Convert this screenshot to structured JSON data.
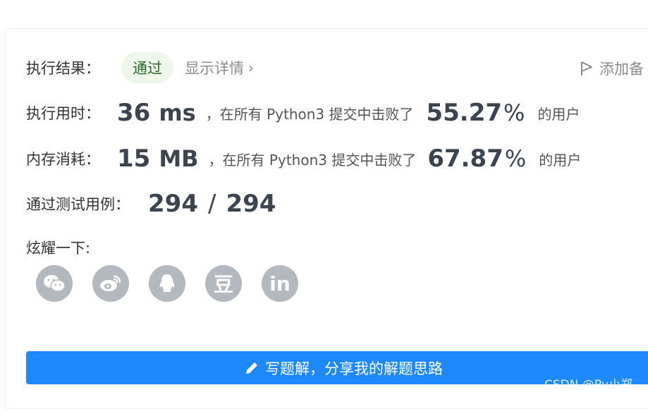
{
  "result": {
    "label": "执行结果：",
    "status": "通过",
    "details_link": "显示详情",
    "add_note": "添加备"
  },
  "runtime": {
    "label": "执行用时：",
    "value": "36",
    "unit": "ms",
    "text_before": "，在所有 Python3 提交中击败了",
    "percent": "55.27",
    "percent_sign": "%",
    "text_after": "的用户"
  },
  "memory": {
    "label": "内存消耗：",
    "value": "15",
    "unit": "MB",
    "text_before": "，在所有 Python3 提交中击败了",
    "percent": "67.87",
    "percent_sign": "%",
    "text_after": "的用户"
  },
  "tests": {
    "label": "通过测试用例：",
    "passed": "294",
    "separator": "/",
    "total": "294"
  },
  "share": {
    "label": "炫耀一下:",
    "icons": [
      "wechat-icon",
      "weibo-icon",
      "qq-icon",
      "douban-icon",
      "linkedin-icon"
    ],
    "douban_glyph": "豆",
    "linkedin_glyph": "in"
  },
  "write_button": {
    "label": "写题解，分享我的解题思路"
  },
  "watermark": "CSDN @Py小郑",
  "colors": {
    "accent": "#1e88ff",
    "success_bg": "#eef7ea",
    "icon_bg": "#b4b8bf"
  }
}
